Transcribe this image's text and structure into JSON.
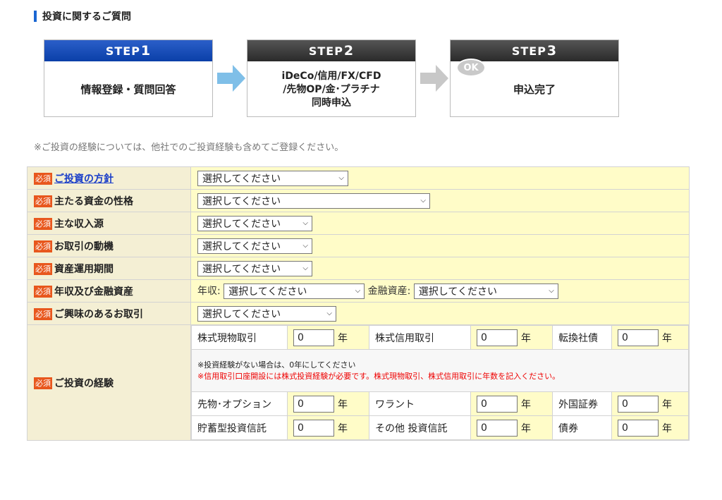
{
  "section_title": "投資に関するご質問",
  "steps": [
    {
      "label": "STEP",
      "num": "1",
      "text_lines": [
        "情報登録・質問回答"
      ]
    },
    {
      "label": "STEP",
      "num": "2",
      "text_lines": [
        "iDeCo/信用/FX/CFD",
        "/先物OP/金･プラチナ",
        "同時申込"
      ]
    },
    {
      "label": "STEP",
      "num": "3",
      "text_lines": [
        "申込完了"
      ],
      "badge": "OK"
    }
  ],
  "note": "※ご投資の経験については、他社でのご投資経験も含めてご登録ください。",
  "required_label": "必須",
  "rows": [
    {
      "label": "ご投資の方針",
      "select": "選択してください"
    },
    {
      "label": "主たる資金の性格",
      "select": "選択してください"
    },
    {
      "label": "主な収入源",
      "select": "選択してください"
    },
    {
      "label": "お取引の動機",
      "select": "選択してください"
    },
    {
      "label": "資産運用期間",
      "select": "選択してください"
    },
    {
      "label": "年収及び金融資産",
      "income_label": "年収:",
      "income_select": "選択してください",
      "assets_label": "金融資産:",
      "assets_select": "選択してください"
    },
    {
      "label": "ご興味のあるお取引",
      "select": "選択してください"
    }
  ],
  "experience": {
    "label": "ご投資の経験",
    "unit": "年",
    "row1": [
      {
        "name": "株式現物取引",
        "value": "0"
      },
      {
        "name": "株式信用取引",
        "value": "0"
      },
      {
        "name": "転換社債",
        "value": "0"
      }
    ],
    "note_line1": "※投資経験がない場合は、0年にしてください",
    "note_line2": "※信用取引口座開設には株式投資経験が必要です。株式現物取引、株式信用取引に年数を記入ください。",
    "row2": [
      {
        "name": "先物･オプション",
        "value": "0"
      },
      {
        "name": "ワラント",
        "value": "0"
      },
      {
        "name": "外国証券",
        "value": "0"
      }
    ],
    "row3": [
      {
        "name": "貯蓄型投資信託",
        "value": "0"
      },
      {
        "name": "その他 投資信託",
        "value": "0"
      },
      {
        "name": "債券",
        "value": "0"
      }
    ]
  },
  "colors": {
    "step1": "#0a3fa8",
    "step_dark": "#2a2a2a",
    "required": "#e8571d",
    "field_bg": "#fffcc8",
    "label_bg": "#f4efd4",
    "link": "#1a3ec9"
  }
}
